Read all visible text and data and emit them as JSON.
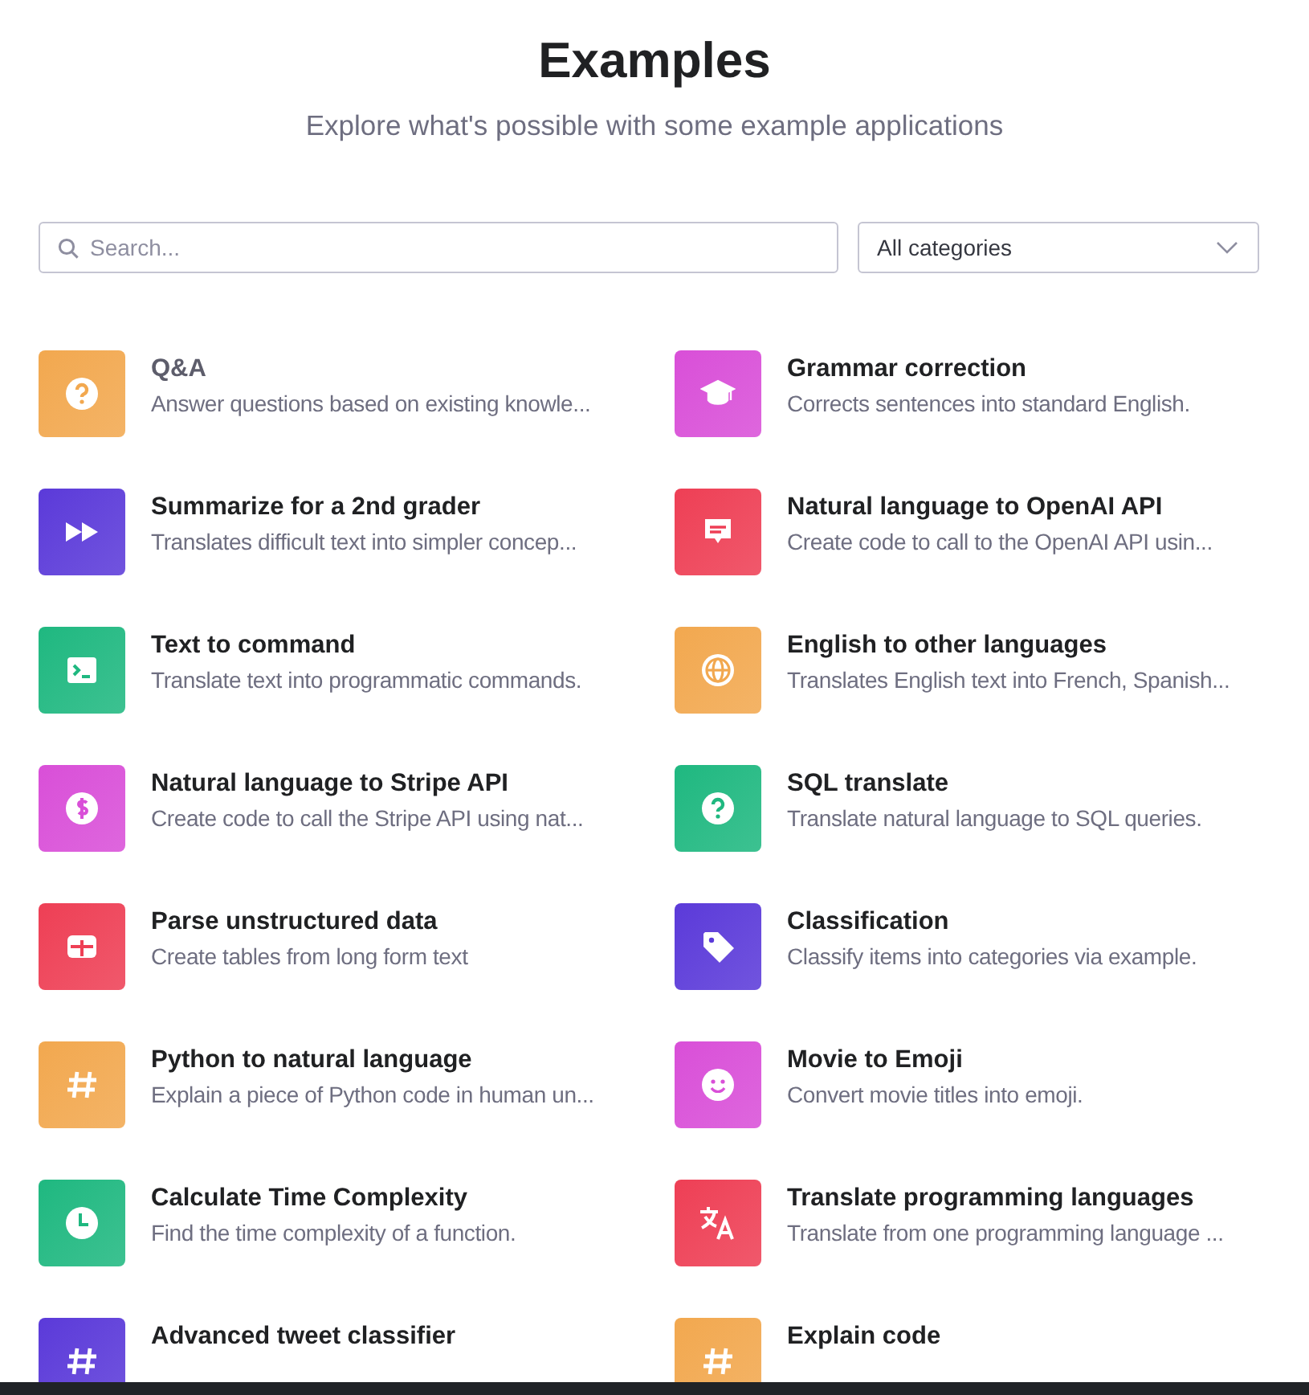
{
  "header": {
    "title": "Examples",
    "subtitle": "Explore what's possible with some example applications"
  },
  "search": {
    "placeholder": "Search..."
  },
  "category_select": {
    "value": "All categories"
  },
  "examples": [
    {
      "title": "Q&A",
      "description": "Answer questions based on existing knowle...",
      "kind": "question",
      "color": "#f2a84f",
      "highlighted": true
    },
    {
      "title": "Grammar correction",
      "description": "Corrects sentences into standard English.",
      "kind": "graduation",
      "color": "#d94fd8",
      "highlighted": false
    },
    {
      "title": "Summarize for a 2nd grader",
      "description": "Translates difficult text into simpler concep...",
      "kind": "forward",
      "color": "#5b3ad9",
      "highlighted": false
    },
    {
      "title": "Natural language to OpenAI API",
      "description": "Create code to call to the OpenAI API usin...",
      "kind": "chat",
      "color": "#ee3f55",
      "highlighted": false
    },
    {
      "title": "Text to command",
      "description": "Translate text into programmatic commands.",
      "kind": "terminal",
      "color": "#1fb880",
      "highlighted": false
    },
    {
      "title": "English to other languages",
      "description": "Translates English text into French, Spanish...",
      "kind": "globe",
      "color": "#f2a84f",
      "highlighted": false
    },
    {
      "title": "Natural language to Stripe API",
      "description": "Create code to call the Stripe API using nat...",
      "kind": "dollar",
      "color": "#d94fd8",
      "highlighted": false
    },
    {
      "title": "SQL translate",
      "description": "Translate natural language to SQL queries.",
      "kind": "question",
      "color": "#1fb880",
      "highlighted": false
    },
    {
      "title": "Parse unstructured data",
      "description": "Create tables from long form text",
      "kind": "table",
      "color": "#ee3f55",
      "highlighted": false
    },
    {
      "title": "Classification",
      "description": "Classify items into categories via example.",
      "kind": "tag",
      "color": "#5b3ad9",
      "highlighted": false
    },
    {
      "title": "Python to natural language",
      "description": "Explain a piece of Python code in human un...",
      "kind": "hash",
      "color": "#f2a84f",
      "highlighted": false
    },
    {
      "title": "Movie to Emoji",
      "description": "Convert movie titles into emoji.",
      "kind": "smile",
      "color": "#d94fd8",
      "highlighted": false
    },
    {
      "title": "Calculate Time Complexity",
      "description": "Find the time complexity of a function.",
      "kind": "clock",
      "color": "#1fb880",
      "highlighted": false
    },
    {
      "title": "Translate programming languages",
      "description": "Translate from one programming language ...",
      "kind": "translate",
      "color": "#ee3f55",
      "highlighted": false
    },
    {
      "title": "Advanced tweet classifier",
      "kind": "hash",
      "color": "#5b3ad9",
      "highlighted": false
    },
    {
      "title": "Explain code",
      "kind": "hash",
      "color": "#f2a84f",
      "highlighted": false
    }
  ]
}
